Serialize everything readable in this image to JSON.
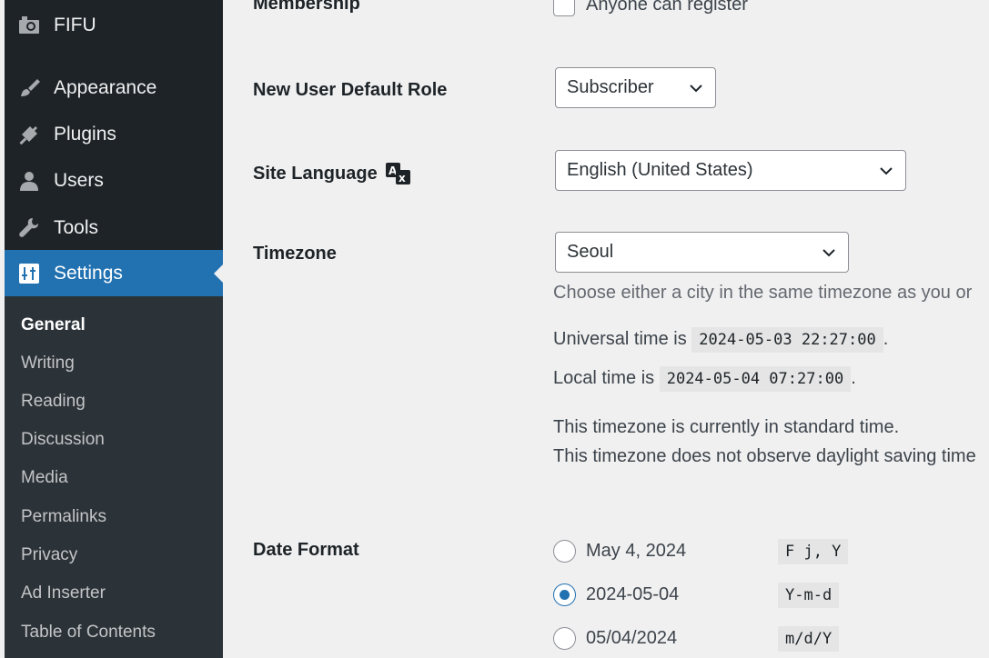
{
  "sidebar": {
    "items": [
      {
        "label": "FIFU",
        "icon": "camera-icon"
      },
      {
        "label": "Appearance",
        "icon": "paintbrush-icon"
      },
      {
        "label": "Plugins",
        "icon": "plug-icon"
      },
      {
        "label": "Users",
        "icon": "user-icon"
      },
      {
        "label": "Tools",
        "icon": "wrench-icon"
      },
      {
        "label": "Settings",
        "icon": "sliders-icon"
      }
    ],
    "submenu": [
      "General",
      "Writing",
      "Reading",
      "Discussion",
      "Media",
      "Permalinks",
      "Privacy",
      "Ad Inserter",
      "Table of Contents"
    ]
  },
  "colors": {
    "sidebar_bg": "#1d2327",
    "submenu_bg": "#2c3338",
    "accent": "#2271b1",
    "page_bg": "#f0f0f1"
  },
  "form": {
    "membership": {
      "label": "Membership",
      "checkbox_label": "Anyone can register",
      "checked": false
    },
    "default_role": {
      "label": "New User Default Role",
      "value": "Subscriber"
    },
    "site_language": {
      "label": "Site Language",
      "value": "English (United States)",
      "icon": "translate-icon"
    },
    "timezone": {
      "label": "Timezone",
      "value": "Seoul",
      "hint": "Choose either a city in the same timezone as you or",
      "universal_prefix": "Universal time is",
      "universal_time": "2024-05-03 22:27:00",
      "local_prefix": "Local time is",
      "local_time": "2024-05-04 07:27:00",
      "period": ".",
      "dst_line1": "This timezone is currently in standard time.",
      "dst_line2": "This timezone does not observe daylight saving time"
    },
    "date_format": {
      "label": "Date Format",
      "options": [
        {
          "display": "May 4, 2024",
          "code": "F j, Y",
          "checked": false
        },
        {
          "display": "2024-05-04",
          "code": "Y-m-d",
          "checked": true
        },
        {
          "display": "05/04/2024",
          "code": "m/d/Y",
          "checked": false
        }
      ]
    }
  }
}
